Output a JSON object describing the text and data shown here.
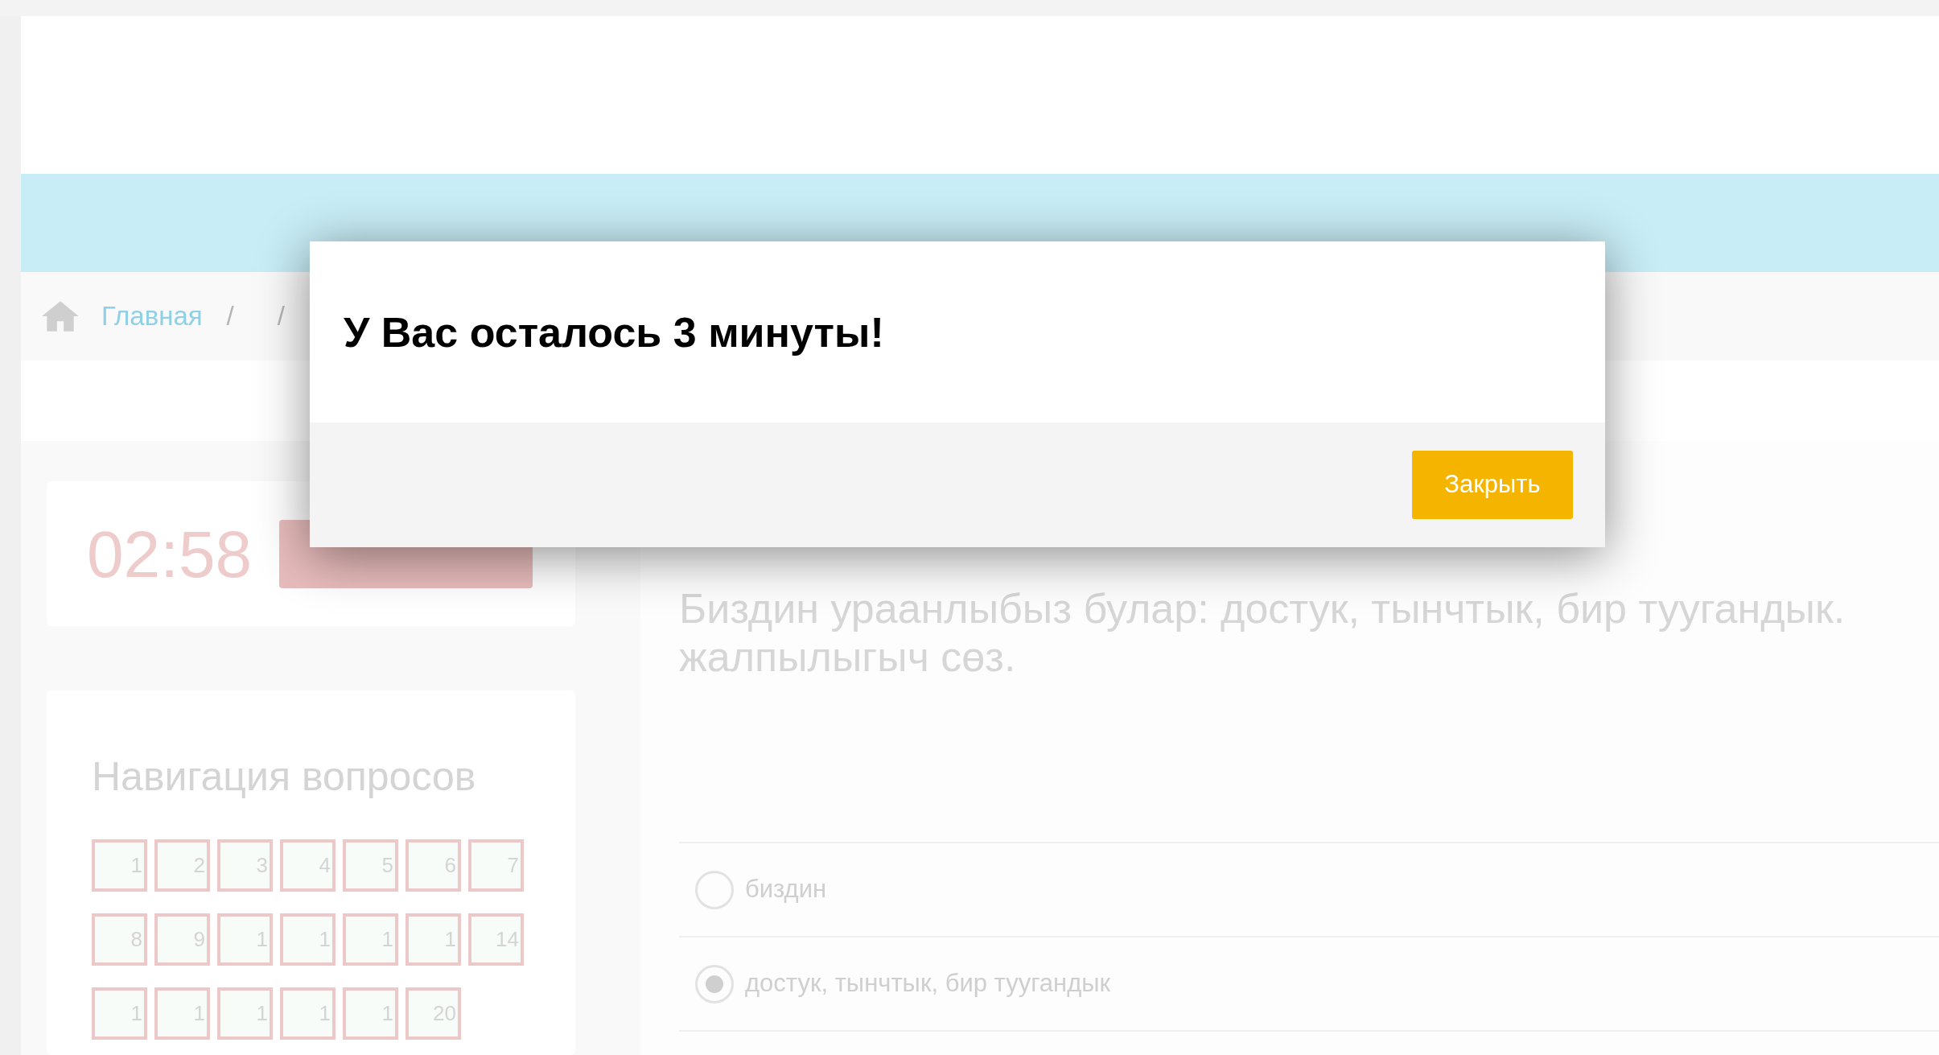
{
  "breadcrumb": {
    "items": [
      "Главная"
    ],
    "separators": [
      "/",
      "/"
    ]
  },
  "timer": {
    "time": "02:58"
  },
  "navigation": {
    "title": "Навигация вопросов",
    "buttons": [
      {
        "label": "1"
      },
      {
        "label": "2"
      },
      {
        "label": "3"
      },
      {
        "label": "4"
      },
      {
        "label": "5"
      },
      {
        "label": "6"
      },
      {
        "label": "7"
      },
      {
        "label": "8"
      },
      {
        "label": "9"
      },
      {
        "label": "1"
      },
      {
        "label": "1"
      },
      {
        "label": "1"
      },
      {
        "label": "1"
      },
      {
        "label": "14"
      },
      {
        "label": "1"
      },
      {
        "label": "1"
      },
      {
        "label": "1"
      },
      {
        "label": "1"
      },
      {
        "label": "1"
      },
      {
        "label": "20"
      }
    ]
  },
  "question": {
    "text_lines": [
      "Биздин ураанлыбыз булар: достук, тынчтык, бир туугандык.",
      "жалпылыгыч сөз."
    ],
    "options": [
      {
        "label": "биздин",
        "selected": false
      },
      {
        "label": "достук, тынчтык, бир туугандык",
        "selected": true
      }
    ]
  },
  "modal": {
    "title": "У Вас осталось 3 минуты!",
    "close_button": "Закрыть"
  }
}
